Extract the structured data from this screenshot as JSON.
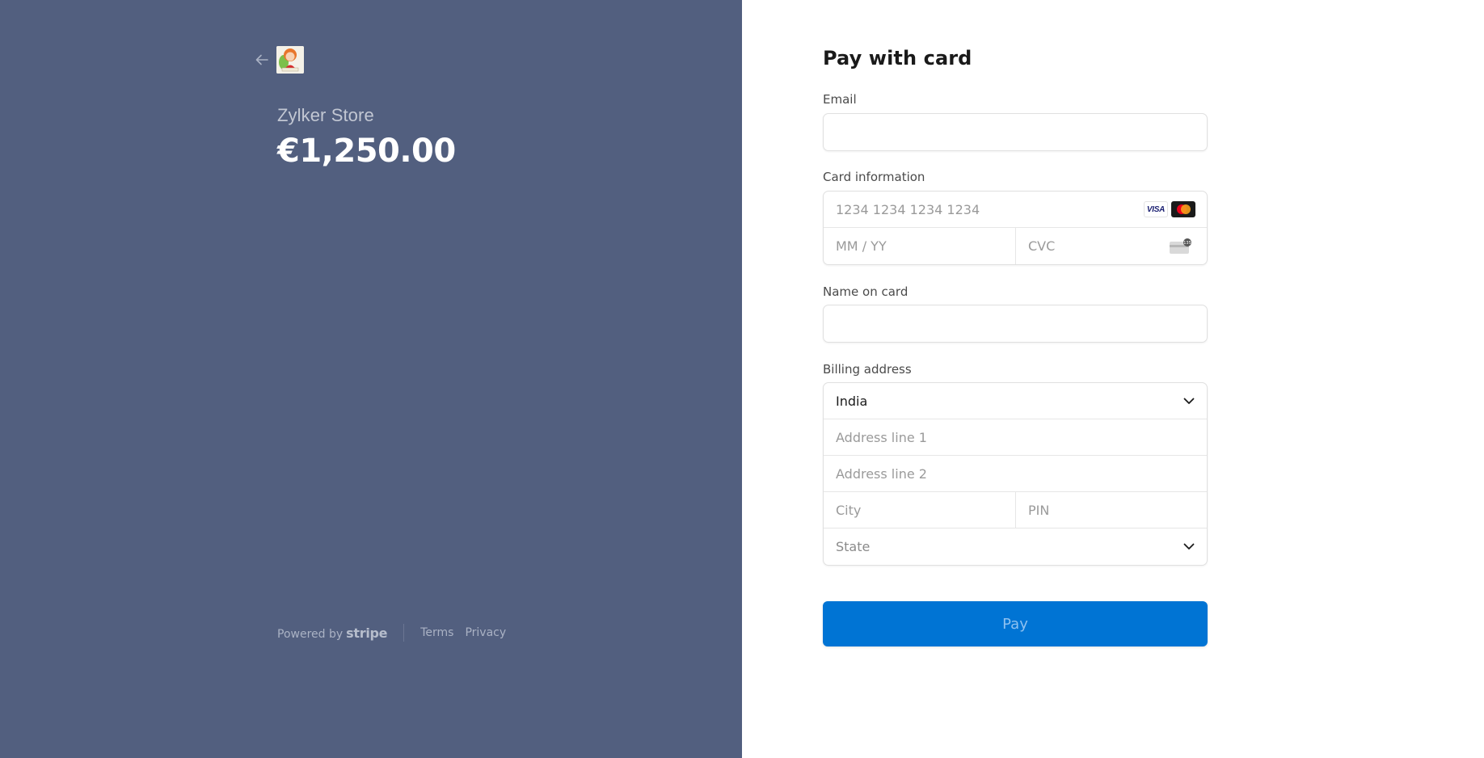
{
  "merchant": {
    "back_label": "Back",
    "name": "Zylker Store",
    "amount": "€1,250.00"
  },
  "footer": {
    "powered_by": "Powered by",
    "brand": "stripe",
    "terms": "Terms",
    "privacy": "Privacy"
  },
  "form": {
    "title": "Pay with card",
    "email": {
      "label": "Email",
      "value": "",
      "placeholder": ""
    },
    "card": {
      "label": "Card information",
      "number_placeholder": "1234 1234 1234 1234",
      "expiry_placeholder": "MM / YY",
      "cvc_placeholder": "CVC",
      "brands": [
        "visa",
        "mastercard"
      ],
      "visa_text": "VISA",
      "cvc_hint": "135"
    },
    "name": {
      "label": "Name on card",
      "value": "",
      "placeholder": ""
    },
    "billing": {
      "label": "Billing address",
      "country": "India",
      "address1_placeholder": "Address line 1",
      "address2_placeholder": "Address line 2",
      "city_placeholder": "City",
      "pin_placeholder": "PIN",
      "state_placeholder": "State"
    },
    "pay_label": "Pay"
  },
  "colors": {
    "left_panel": "#525f7f",
    "pay_button": "#0074d4",
    "pay_text": "#8ec1f0"
  }
}
